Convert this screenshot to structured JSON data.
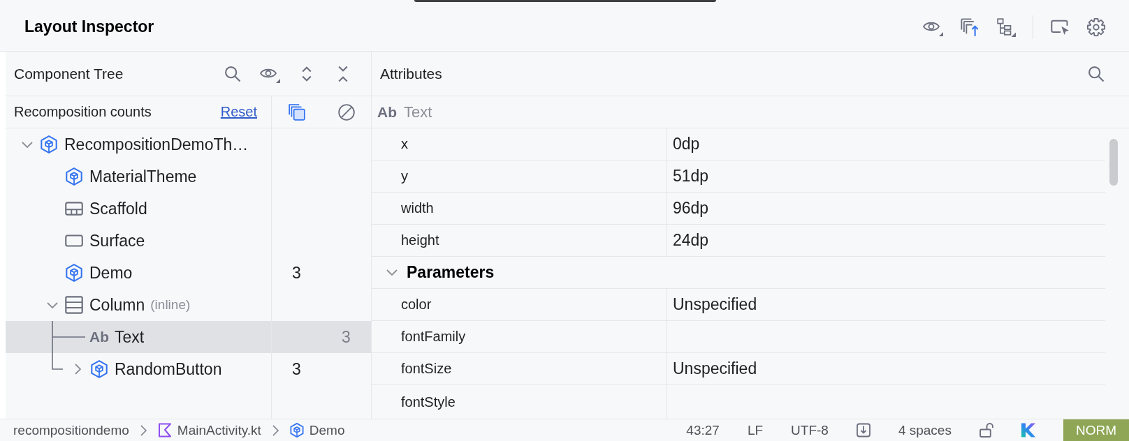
{
  "window": {
    "title": "Layout Inspector"
  },
  "component_tree": {
    "title": "Component Tree",
    "counts_label": "Recomposition counts",
    "reset_link": "Reset",
    "nodes": [
      {
        "name": "RecompositionDemoTh…",
        "kind": "composable",
        "expanded": true,
        "selected": false,
        "children": [
          {
            "name": "MaterialTheme",
            "kind": "composable",
            "selected": false
          },
          {
            "name": "Scaffold",
            "kind": "scaffold",
            "selected": false
          },
          {
            "name": "Surface",
            "kind": "surface",
            "selected": false
          },
          {
            "name": "Demo",
            "kind": "composable",
            "selected": false,
            "recompositions": "3"
          },
          {
            "name": "Column",
            "note": "(inline)",
            "kind": "column",
            "expanded": true,
            "selected": false,
            "children": [
              {
                "name": "Text",
                "glyph": "Ab",
                "kind": "text",
                "selected": true,
                "skips": "3"
              },
              {
                "name": "RandomButton",
                "kind": "composable",
                "expanded": false,
                "selected": false,
                "recompositions": "3"
              }
            ]
          }
        ]
      }
    ]
  },
  "attributes": {
    "title": "Attributes",
    "node": {
      "glyph": "Ab",
      "name": "Text"
    },
    "rows": [
      {
        "name": "x",
        "value": "0dp"
      },
      {
        "name": "y",
        "value": "51dp"
      },
      {
        "name": "width",
        "value": "96dp"
      },
      {
        "name": "height",
        "value": "24dp"
      }
    ],
    "sections": [
      {
        "title": "Parameters",
        "expanded": true,
        "rows": [
          {
            "name": "color",
            "value": "Unspecified"
          },
          {
            "name": "fontFamily"
          },
          {
            "name": "fontSize",
            "value": "Unspecified"
          },
          {
            "name": "fontStyle"
          }
        ]
      }
    ]
  },
  "status_bar": {
    "breadcrumbs": [
      {
        "label": "recompositiondemo",
        "kind": "module"
      },
      {
        "label": "MainActivity.kt",
        "kind": "file"
      },
      {
        "label": "Demo",
        "kind": "composable"
      }
    ],
    "position": "43:27",
    "line_separator": "LF",
    "encoding": "UTF-8",
    "indent": "4 spaces",
    "mode": "NORM"
  }
}
